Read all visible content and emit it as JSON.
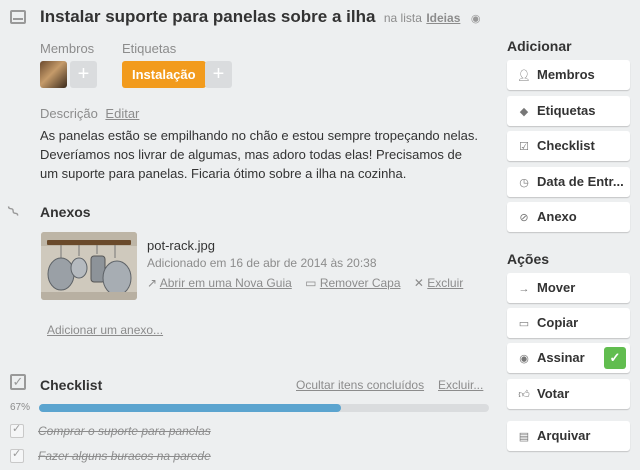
{
  "card": {
    "title": "Instalar suporte para panelas sobre a ilha",
    "in_list_prefix": "na lista",
    "list_name": "Ideias"
  },
  "members": {
    "label": "Membros",
    "add": "+"
  },
  "labels": {
    "label": "Etiquetas",
    "items": [
      "Instalação"
    ],
    "add": "+",
    "color": "#f29b1d"
  },
  "description": {
    "label": "Descrição",
    "edit": "Editar",
    "text": "As panelas estão se empilhando no chão e estou sempre tropeçando nelas. Deveríamos nos livrar de algumas, mas adoro todas elas! Precisamos de um suporte para panelas. Ficaria ótimo sobre a ilha na cozinha."
  },
  "attachments": {
    "title": "Anexos",
    "file": {
      "name": "pot-rack.jpg",
      "added": "Adicionado em 16 de abr de 2014 às 20:38",
      "open": "Abrir em uma Nova Guia",
      "remove_cover": "Remover Capa",
      "delete": "Excluir"
    },
    "add": "Adicionar um anexo..."
  },
  "checklist": {
    "title": "Checklist",
    "hide_done": "Ocultar itens concluídos",
    "delete": "Excluir...",
    "percent_label": "67%",
    "progress": 0.67,
    "items": [
      {
        "text": "Comprar o suporte para panelas",
        "done": true
      },
      {
        "text": "Fazer alguns buracos na parede",
        "done": true
      }
    ]
  },
  "sidebar": {
    "add_title": "Adicionar",
    "add_buttons": [
      {
        "label": "Membros",
        "icon": "person-icon"
      },
      {
        "label": "Etiquetas",
        "icon": "tag-icon"
      },
      {
        "label": "Checklist",
        "icon": "checkbox-icon"
      },
      {
        "label": "Data de Entr...",
        "icon": "clock-icon"
      },
      {
        "label": "Anexo",
        "icon": "paperclip-icon"
      }
    ],
    "actions_title": "Ações",
    "action_buttons": [
      {
        "label": "Mover",
        "icon": "arrow-right-icon"
      },
      {
        "label": "Copiar",
        "icon": "card-icon"
      },
      {
        "label": "Assinar",
        "icon": "eye-icon",
        "checked": true
      },
      {
        "label": "Votar",
        "icon": "thumbs-up-icon"
      },
      {
        "label": "Arquivar",
        "icon": "archive-icon"
      }
    ]
  },
  "colors": {
    "accent_green": "#61bd4f",
    "progress": "#5ba4cf",
    "label_orange": "#f29b1d"
  }
}
